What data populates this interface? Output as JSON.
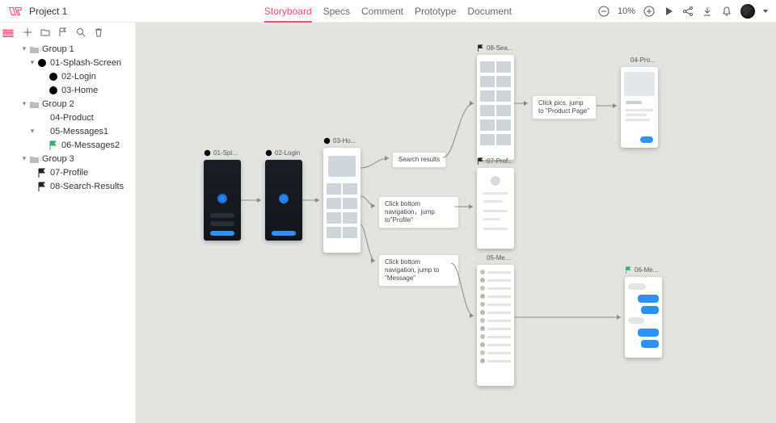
{
  "project_title": "Project 1",
  "tabs": [
    "Storyboard",
    "Specs",
    "Comment",
    "Prototype",
    "Document"
  ],
  "active_tab_index": 0,
  "zoom": "10%",
  "sidebar": {
    "groups": [
      {
        "label": "Group 1",
        "children": [
          {
            "icon": "check",
            "label": "01-Splash-Screen",
            "children": [
              {
                "icon": "check",
                "label": "02-Login"
              },
              {
                "icon": "check",
                "label": "03-Home"
              }
            ]
          },
          null
        ]
      },
      {
        "label": "Group 2",
        "children": [
          {
            "icon": "half",
            "label": "04-Product"
          },
          {
            "icon": "half",
            "label": "05-Messages1",
            "children": [
              {
                "icon": "flag-g",
                "label": "06-Messages2"
              }
            ]
          }
        ]
      },
      {
        "label": "Group 3",
        "children": [
          {
            "icon": "flag-d",
            "label": "07-Profile"
          },
          {
            "icon": "flag-d",
            "label": "08-Search-Results"
          }
        ]
      }
    ]
  },
  "canvas": {
    "frames": {
      "splash": {
        "icon": "check",
        "label": "01-Spl..."
      },
      "login": {
        "icon": "check",
        "label": "02-Login"
      },
      "home": {
        "icon": "check",
        "label": "03-Ho..."
      },
      "search": {
        "icon": "flag-d",
        "label": "08-Sea..."
      },
      "profile": {
        "icon": "flag-d",
        "label": "07-Prof..."
      },
      "messages": {
        "icon": "half",
        "label": "05-Me..."
      },
      "product": {
        "icon": "half",
        "label": "04-Pro..."
      },
      "message2": {
        "icon": "flag-g",
        "label": "06-Me..."
      }
    },
    "notes": {
      "search_results": "Search results",
      "to_profile": "Click bottom navigation，jump to\"Profile\"",
      "to_message": "Click bottom navigation, jump to \"Message\"",
      "to_product": "Click pics, jump to \"Product Page\""
    }
  }
}
